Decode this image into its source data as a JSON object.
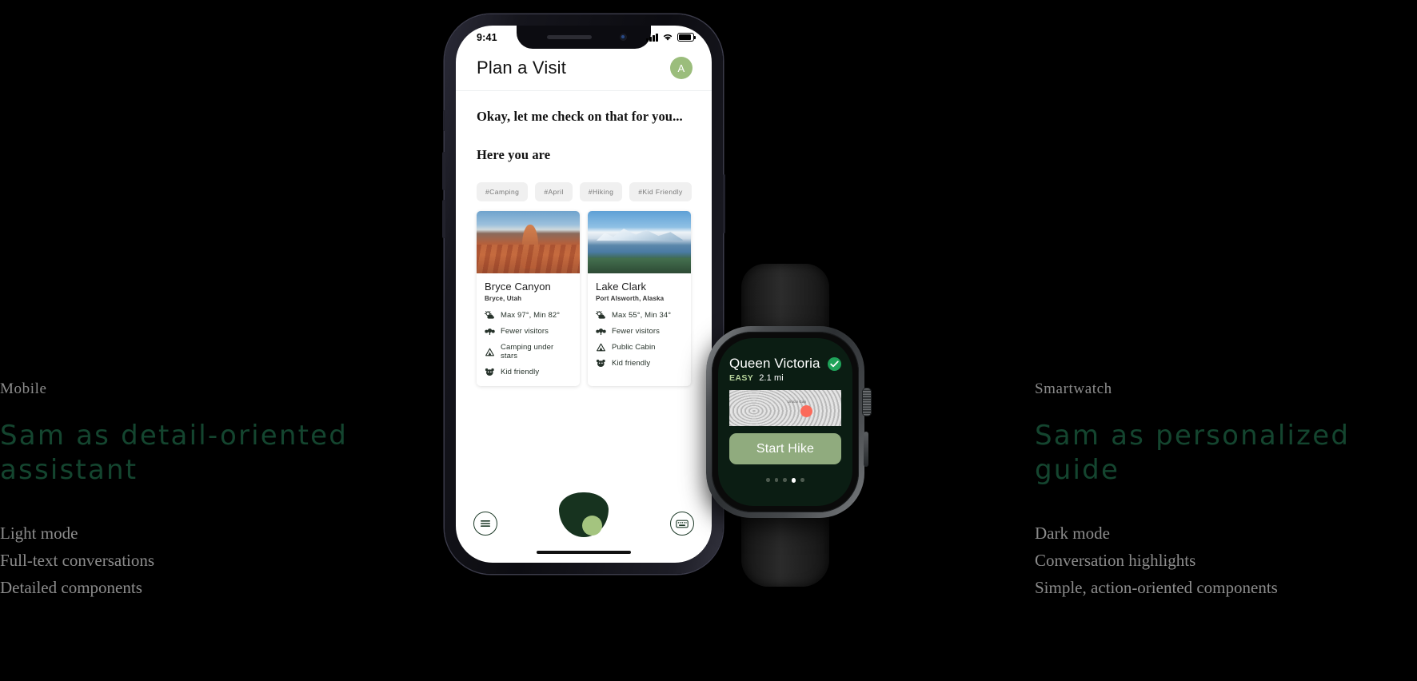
{
  "left_caption": {
    "eyebrow": "Mobile",
    "title": "Sam as detail-oriented assistant",
    "bullets": [
      "Light mode",
      "Full-text conversations",
      "Detailed components"
    ]
  },
  "right_caption": {
    "eyebrow": "Smartwatch",
    "title": "Sam as personalized guide",
    "bullets": [
      "Dark mode",
      "Conversation highlights",
      "Simple, action-oriented components"
    ]
  },
  "phone": {
    "status_bar": {
      "time": "9:41",
      "signal_icon": "cellular-bars-icon",
      "wifi_icon": "wifi-icon",
      "battery_icon": "battery-icon"
    },
    "header": {
      "title": "Plan a Visit",
      "avatar_initial": "A",
      "avatar_color": "#9bbd7c"
    },
    "conversation": [
      "Okay, let me check on that for you...",
      "Here you are"
    ],
    "tags": [
      "#Camping",
      "#April",
      "#Hiking",
      "#Kid Friendly"
    ],
    "cards": [
      {
        "title": "Bryce Canyon",
        "location": "Bryce, Utah",
        "features": [
          {
            "icon": "weather-icon",
            "label": "Max 97°, Min 82°"
          },
          {
            "icon": "visitors-icon",
            "label": "Fewer visitors"
          },
          {
            "icon": "tent-icon",
            "label": "Camping under stars"
          },
          {
            "icon": "bear-icon",
            "label": "Kid friendly"
          }
        ]
      },
      {
        "title": "Lake Clark",
        "location": "Port Alsworth, Alaska",
        "features": [
          {
            "icon": "weather-icon",
            "label": "Max 55°, Min 34°"
          },
          {
            "icon": "visitors-icon",
            "label": "Fewer visitors"
          },
          {
            "icon": "tent-icon",
            "label": "Public Cabin"
          },
          {
            "icon": "bear-icon",
            "label": "Kid friendly"
          }
        ]
      }
    ],
    "bottom_bar": {
      "menu_icon": "hamburger-menu-icon",
      "assistant_icon": "sam-assistant-logo",
      "keyboard_icon": "keyboard-icon"
    }
  },
  "watch": {
    "trail_name": "Queen Victoria",
    "difficulty": "EASY",
    "distance": "2.1 mi",
    "status_icon": "check-circle-icon",
    "map_label": "Unicoi Gap",
    "cta_label": "Start Hike",
    "page_dots": {
      "count": 5,
      "active_index": 3
    },
    "accent_color": "#90ab7e",
    "screen_color": "#0b1d13"
  }
}
